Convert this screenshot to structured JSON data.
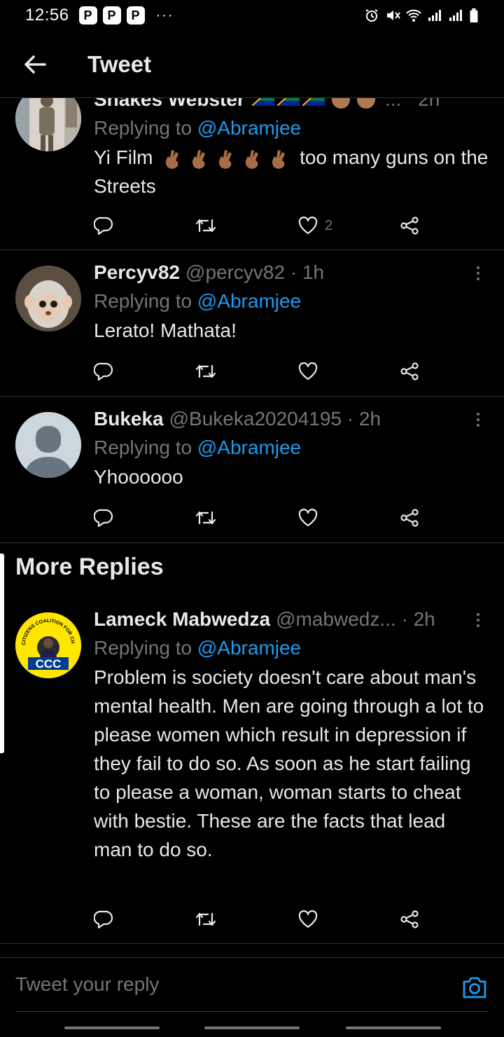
{
  "status_bar": {
    "time": "12:56",
    "notification_badges": [
      "P",
      "P",
      "P"
    ],
    "overflow": "···"
  },
  "header": {
    "title": "Tweet"
  },
  "tweets": [
    {
      "name": "Shakes Webster",
      "handle": "",
      "time": "2h",
      "replying_label": "Replying to",
      "mention": "@Abramjee",
      "text_before": "Yi Film",
      "text_after": "too many guns on the Streets",
      "likes": "2"
    },
    {
      "name": "Percyv82",
      "handle": "@percyv82 · 1h",
      "replying_label": "Replying to",
      "mention": "@Abramjee",
      "text": "Lerato! Mathata!"
    },
    {
      "name": "Bukeka",
      "handle": "@Bukeka20204195 · 2h",
      "replying_label": "Replying to",
      "mention": "@Abramjee",
      "text": "Yhoooooo"
    },
    {
      "name": "Lameck Mabwedza",
      "handle": "@mabwedz... · 2h",
      "replying_label": "Replying to",
      "mention": "@Abramjee",
      "text": "Problem is society doesn't care about man's mental health. Men are going through a lot to please women which result in depression if they fail to do so. As soon as he start failing to please a woman, woman starts to cheat with bestie. These are the facts that lead man to do so."
    }
  ],
  "section": {
    "more_replies": "More Replies"
  },
  "avatar_logo": {
    "ring_text": "CITIZENS COALITION FOR CHANGE",
    "badge": "CCC"
  },
  "reply_bar": {
    "placeholder": "Tweet your reply"
  },
  "colors": {
    "background": "#000000",
    "text": "#e7e9ea",
    "secondary": "#71767b",
    "accent": "#1d9bf0",
    "divider": "#2f3336"
  },
  "icons": [
    "back-arrow-icon",
    "reply-icon",
    "retweet-icon",
    "like-icon",
    "share-icon",
    "more-icon",
    "camera-icon",
    "alarm-icon",
    "mute-icon",
    "wifi-icon",
    "signal-icon",
    "battery-icon"
  ]
}
